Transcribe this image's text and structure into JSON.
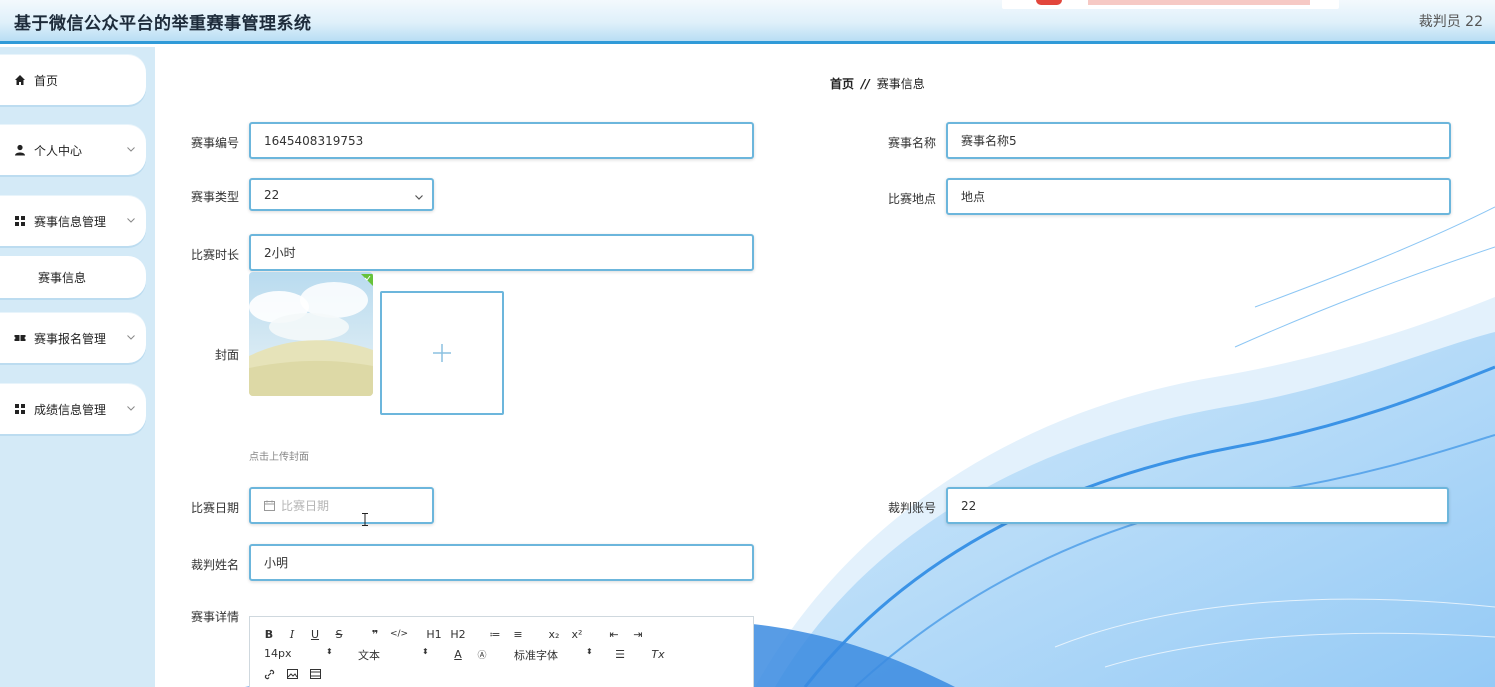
{
  "header": {
    "title": "基于微信公众平台的举重赛事管理系统",
    "user": "裁判员 22"
  },
  "sidebar": {
    "items": [
      {
        "label": "首页",
        "icon": "home-icon"
      },
      {
        "label": "个人中心",
        "icon": "user-icon"
      },
      {
        "label": "赛事信息管理",
        "icon": "grid-icon"
      },
      {
        "label": "赛事信息",
        "icon": ""
      },
      {
        "label": "赛事报名管理",
        "icon": "ticket-icon"
      },
      {
        "label": "成绩信息管理",
        "icon": "grid-icon"
      }
    ]
  },
  "breadcrumb": {
    "home": "首页",
    "sep": "//",
    "current": "赛事信息"
  },
  "form": {
    "event_no_label": "赛事编号",
    "event_no": "1645408319753",
    "event_name_label": "赛事名称",
    "event_name": "赛事名称5",
    "event_type_label": "赛事类型",
    "event_type": "22",
    "venue_label": "比赛地点",
    "venue": "地点",
    "duration_label": "比赛时长",
    "duration": "2小时",
    "cover_label": "封面",
    "cover_tip": "点击上传封面",
    "date_label": "比赛日期",
    "date_placeholder": "比赛日期",
    "referee_account_label": "裁判账号",
    "referee_account": "22",
    "referee_name_label": "裁判姓名",
    "referee_name": "小明",
    "detail_label": "赛事详情"
  },
  "editor": {
    "row1": [
      "B",
      "I",
      "U",
      "S",
      "❞",
      "</>",
      "H1",
      "H2",
      "≔",
      "≡",
      "x₂",
      "x²",
      "⇤",
      "⇥"
    ],
    "font_size": "14px",
    "text_style": "文本",
    "font_family": "标准字体",
    "clear": "Tx"
  },
  "colors": {
    "accent": "#2f9ad8",
    "field_border": "#6cb6dc",
    "sidebar_bg": "#d4eaf7"
  }
}
